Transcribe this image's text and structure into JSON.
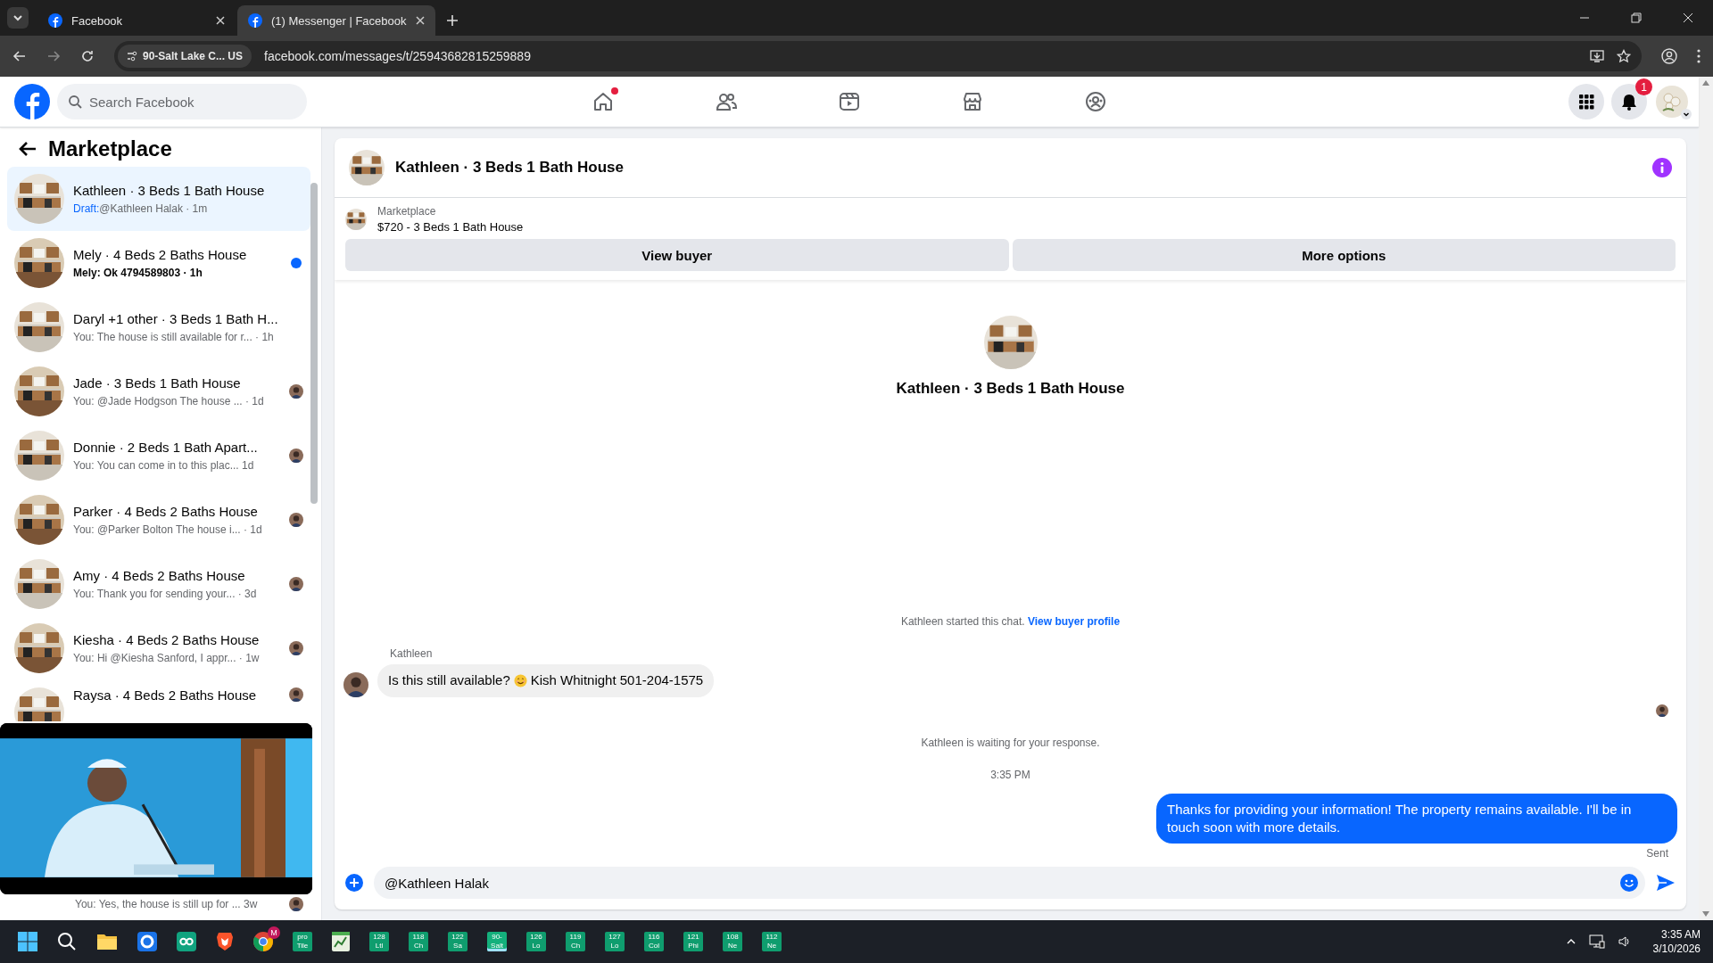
{
  "browser": {
    "tabs": [
      {
        "title": "Facebook",
        "selected": false
      },
      {
        "title": "(1) Messenger | Facebook",
        "selected": true
      }
    ],
    "site_chip": "90-Salt Lake C... US",
    "url": "facebook.com/messages/t/25943682815259889"
  },
  "header": {
    "search": {
      "placeholder": "Search Facebook"
    },
    "nav": [
      {
        "selected": false,
        "dot": true
      },
      {
        "selected": false,
        "dot": false
      },
      {
        "selected": false,
        "dot": false
      },
      {
        "selected": false,
        "dot": false
      },
      {
        "selected": false,
        "dot": false
      }
    ],
    "notifications_badge": "1"
  },
  "sidebar": {
    "title": "Marketplace",
    "threads": [
      {
        "title": "Kathleen · 3 Beds 1 Bath House",
        "draft_label": "Draft:",
        "preview": "@Kathleen Halak · 1m",
        "selected": true,
        "unread": false,
        "seen_avatar": false
      },
      {
        "title": "Mely · 4 Beds 2 Baths House",
        "preview": "Mely: Ok 4794589803 · 1h",
        "selected": false,
        "unread": true,
        "seen_avatar": false
      },
      {
        "title": "Daryl +1 other · 3 Beds 1 Bath H...",
        "preview": "You: The house is still available for r... · 1h",
        "selected": false,
        "unread": false,
        "seen_avatar": false
      },
      {
        "title": "Jade · 3 Beds 1 Bath House",
        "preview": "You: @Jade Hodgson The house ... · 1d",
        "selected": false,
        "unread": false,
        "seen_avatar": true
      },
      {
        "title": "Donnie · 2 Beds 1 Bath Apart...",
        "preview": "You: You can come in to this plac... 1d",
        "selected": false,
        "unread": false,
        "seen_avatar": true
      },
      {
        "title": "Parker · 4 Beds 2 Baths House",
        "preview": "You: @Parker Bolton The house i... · 1d",
        "selected": false,
        "unread": false,
        "seen_avatar": true
      },
      {
        "title": "Amy · 4 Beds 2 Baths House",
        "preview": "You: Thank you for sending your... · 3d",
        "selected": false,
        "unread": false,
        "seen_avatar": true
      },
      {
        "title": "Kiesha · 4 Beds 2 Baths House",
        "preview": "You: Hi @Kiesha Sanford, I appr... · 1w",
        "selected": false,
        "unread": false,
        "seen_avatar": true
      },
      {
        "title": "Raysa · 4 Beds 2 Baths House",
        "selected": false,
        "unread": false,
        "seen_avatar": true
      }
    ],
    "threads_below_overlay": [
      {
        "preview": "You: Yes, the house is still up for ... 3w",
        "selected": false,
        "unread": false,
        "seen_avatar": true
      }
    ]
  },
  "chat": {
    "title": "Kathleen · 3 Beds 1 Bath House",
    "listing": {
      "label": "Marketplace",
      "text": "$720 - 3 Beds 1 Bath House"
    },
    "buttons": [
      "View buyer",
      "More options"
    ],
    "intro_title": "Kathleen · 3 Beds 1 Bath House",
    "started_text": "Kathleen started this chat.",
    "started_link": "View buyer profile",
    "messages": [
      {
        "kind": "incoming",
        "sender": "Kathleen",
        "text_before": "Is this still available?",
        "text_after": "Kish Whitnight 501-204-1575"
      },
      {
        "kind": "notice",
        "text": "Kathleen is waiting for your response."
      },
      {
        "kind": "time",
        "text": "3:35 PM"
      },
      {
        "kind": "outgoing",
        "text": "Thanks for providing your information! The property remains available. I'll be in touch soon with more details.",
        "status": "Sent"
      }
    ],
    "composer": {
      "value": "@Kathleen Halak"
    }
  },
  "taskbar": {
    "chrome_badge": "M",
    "tiles": [
      {
        "lines": [
          "pro",
          "Tile"
        ],
        "selected": false
      },
      {
        "lines": [
          "128",
          "Ltl"
        ],
        "selected": false
      },
      {
        "lines": [
          "118",
          "Ch"
        ],
        "selected": false
      },
      {
        "lines": [
          "122",
          "Sa"
        ],
        "selected": false
      },
      {
        "lines": [
          "90-",
          "Salt"
        ],
        "selected": true
      },
      {
        "lines": [
          "126",
          "Lo"
        ],
        "selected": false
      },
      {
        "lines": [
          "119",
          "Ch"
        ],
        "selected": false
      },
      {
        "lines": [
          "127",
          "Lo"
        ],
        "selected": false
      },
      {
        "lines": [
          "116",
          "Col"
        ],
        "selected": false
      },
      {
        "lines": [
          "121",
          "Phi"
        ],
        "selected": false
      },
      {
        "lines": [
          "108",
          "Ne"
        ],
        "selected": false
      },
      {
        "lines": [
          "112",
          "Ne"
        ],
        "selected": false
      }
    ],
    "time": "3:35 AM",
    "date": "3/10/2026"
  }
}
